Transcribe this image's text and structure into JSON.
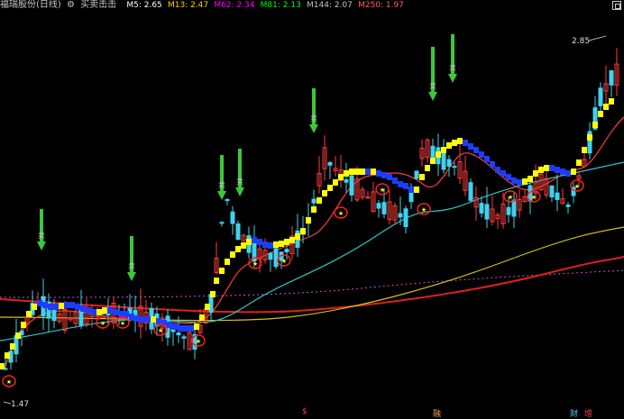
{
  "header": {
    "title": "福瑞股份(日线)",
    "gear_icon": "gear-icon",
    "indicator_name": "买卖击击",
    "ma_readouts": [
      {
        "label": "M5: 2.65",
        "color": "#ffffff"
      },
      {
        "label": "M13: 2.47",
        "color": "#ffd000"
      },
      {
        "label": "M62: 2.34",
        "color": "#ff00ff"
      },
      {
        "label": "M81: 2.13",
        "color": "#00ff00"
      },
      {
        "label": "M144: 2.07",
        "color": "#c0c0c0"
      },
      {
        "label": "M250: 1.97",
        "color": "#ff6060"
      }
    ]
  },
  "chart_data": {
    "type": "candlestick",
    "price_range": [
      1.4,
      2.95
    ],
    "high_marker": "2.85",
    "low_marker": "1.47",
    "buy_signal_text": "卖",
    "sell_signal_text": "卖",
    "star_glyph": "★",
    "colors": {
      "up_candle": "#ff3b3b",
      "down_candle": "#3fd2f0",
      "step_up": "#ffff00",
      "step_down": "#1e3cff",
      "ma_short": "#ff3b3b",
      "ma_mid": "#28c8c8",
      "ma_long_yellow": "#d4c020",
      "ma_long_red": "#e02020",
      "dotted": "#d050d0",
      "arrow": "#3cc83c",
      "circle": "#ff2020"
    },
    "bottom_labels": [
      {
        "text": "$",
        "color": "#ff3b3b"
      },
      {
        "text": "融",
        "color": "#ff9a3c"
      },
      {
        "text": "财",
        "color": "#40d0ff"
      },
      {
        "text": "增",
        "color": "#ff3b3b"
      }
    ]
  }
}
